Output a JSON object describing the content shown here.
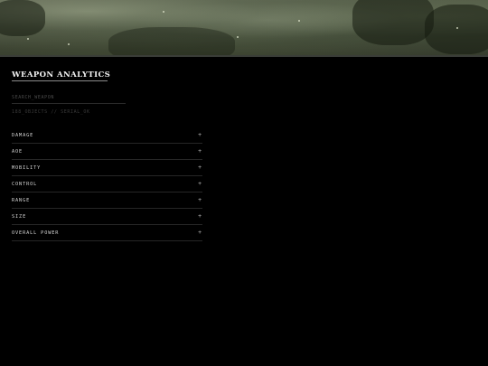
{
  "header": {
    "title": "WEAPON ANALYTICS"
  },
  "search": {
    "placeholder": "SEARCH_WEAPON"
  },
  "stats": {
    "text": "188_OBJECTS // SERIAL_OK"
  },
  "categories": [
    {
      "label": "DAMAGE",
      "expand_icon": "+"
    },
    {
      "label": "AOE",
      "expand_icon": "+"
    },
    {
      "label": "MOBILITY",
      "expand_icon": "+"
    },
    {
      "label": "CONTROL",
      "expand_icon": "+"
    },
    {
      "label": "RANGE",
      "expand_icon": "+"
    },
    {
      "label": "SIZE",
      "expand_icon": "+"
    },
    {
      "label": "OVERALL POWER",
      "expand_icon": "+"
    }
  ],
  "colors": {
    "background": "#000000",
    "text": "#d6d6d6",
    "divider": "#262626"
  }
}
